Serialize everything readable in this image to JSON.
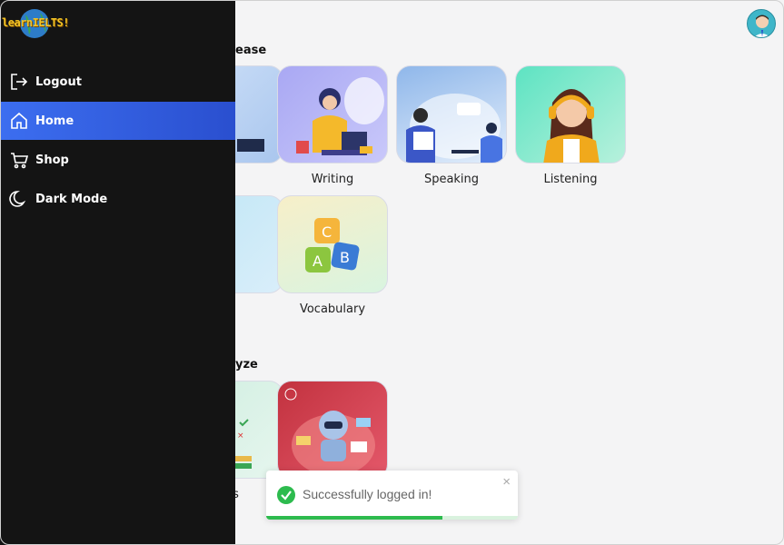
{
  "app": {
    "logo_text": "learnIELTS!"
  },
  "sidebar": {
    "items": [
      {
        "label": "Logout",
        "icon": "logout-icon"
      },
      {
        "label": "Home",
        "icon": "home-icon",
        "active": true
      },
      {
        "label": "Shop",
        "icon": "cart-icon"
      },
      {
        "label": "Dark Mode",
        "icon": "moon-icon"
      }
    ]
  },
  "sections": [
    {
      "title_visible": "ease"
    },
    {
      "title_visible": "yze"
    }
  ],
  "skills": {
    "writing": "Writing",
    "speaking": "Speaking",
    "listening": "Listening",
    "vocabulary": "Vocabulary",
    "partial_label": "ts"
  },
  "toast": {
    "message": "Successfully logged in!",
    "close": "×",
    "progress": 0.7
  },
  "colors": {
    "accent": "#3c6ef0",
    "success": "#2dbb4e",
    "sidebar_bg": "#141414"
  }
}
